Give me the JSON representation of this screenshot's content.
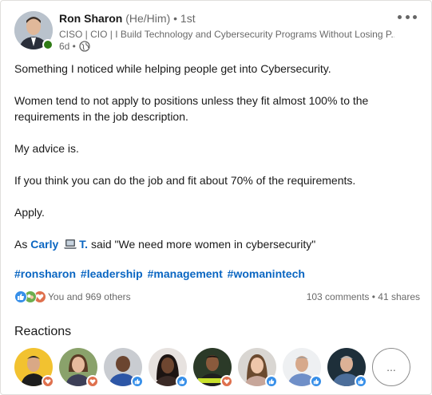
{
  "post": {
    "author": {
      "name": "Ron Sharon",
      "pronouns": "(He/Him)",
      "degree": "• 1st",
      "headline": "CISO | CIO | I Build Technology and Cybersecurity Programs Without Losing P...",
      "time": "6d •",
      "presence_color": "#2f7b15"
    },
    "paragraphs": {
      "p1": "Something I noticed while helping people get into Cybersecurity.",
      "p2": "Women tend to not apply to positions unless they fit almost 100% to the requirements in the job description.",
      "p3": "My advice is.",
      "p4": "If you think you can do the job and fit about 70% of the requirements.",
      "p5": "Apply.",
      "p6_pre": "As",
      "p6_mention_first": "Carly",
      "p6_mention_last": "T.",
      "p6_post": "said \"We need more women in cybersecurity\""
    },
    "hashtags": [
      "#ronsharon",
      "#leadership",
      "#management",
      "#womanintech"
    ],
    "social": {
      "reactions_text": "You and 969 others",
      "comments": "103 comments",
      "separator": "•",
      "shares": "41 shares",
      "reaction_icons": [
        "like-icon",
        "support-icon",
        "love-icon"
      ]
    },
    "reactions_section": {
      "title": "Reactions",
      "more_label": "...",
      "reactors": [
        {
          "badge": "love"
        },
        {
          "badge": "love"
        },
        {
          "badge": "like"
        },
        {
          "badge": "like"
        },
        {
          "badge": "love"
        },
        {
          "badge": "like"
        },
        {
          "badge": "like"
        },
        {
          "badge": "like"
        }
      ]
    },
    "colors": {
      "link": "#0a66c2",
      "like": "#378fe9",
      "support": "#6dae4f",
      "love": "#df704d"
    }
  }
}
